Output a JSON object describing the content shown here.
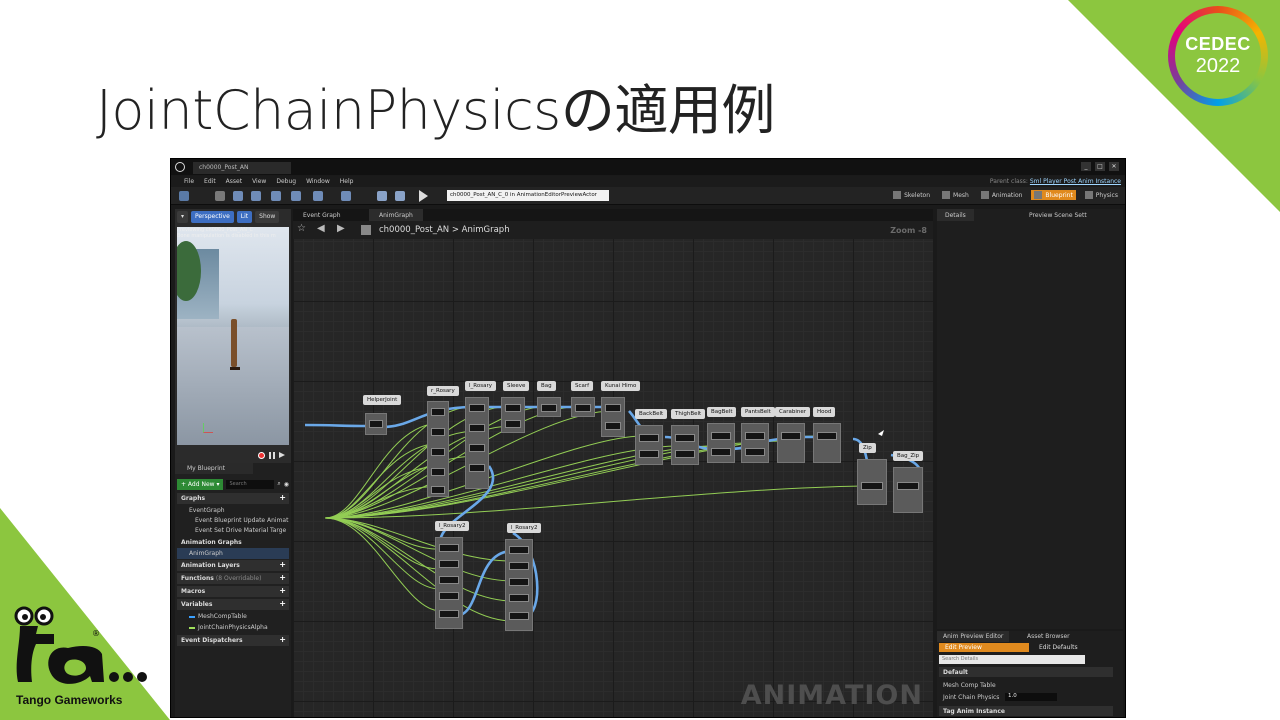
{
  "slide": {
    "title": "JointChainPhysicsの適用例",
    "cedec": {
      "name": "CEDEC",
      "year": "2022"
    },
    "company": "Tango Gameworks"
  },
  "editor": {
    "asset_tab": "ch0000_Post_AN",
    "parent_class_label": "Parent class:",
    "parent_class_value": "Sml Player Post Anim Instance",
    "menu": [
      "File",
      "Edit",
      "Asset",
      "View",
      "Debug",
      "Window",
      "Help"
    ],
    "debug_object": "ch0000_Post_AN_C_0 in AnimationEditorPreviewActor",
    "modes": [
      {
        "label": "Skeleton",
        "active": false
      },
      {
        "label": "Mesh",
        "active": false
      },
      {
        "label": "Animation",
        "active": false
      },
      {
        "label": "Blueprint",
        "active": true
      },
      {
        "label": "Physics",
        "active": false
      }
    ],
    "viewport": {
      "perspective": "Perspective",
      "lit": "Lit",
      "show": "Show",
      "message_line1": "Previewing ch0000_Post_AN_C",
      "message_line2": "Bone manipulation is disabled in this m"
    },
    "my_blueprint": {
      "tab": "My Blueprint",
      "add_new": "+ Add New ▾",
      "search_placeholder": "Search",
      "graphs": "Graphs",
      "event_graph": "EventGraph",
      "event1": "Event Blueprint Update Animat",
      "event2": "Event Set Drive Material Targe",
      "animation_graphs": "Animation Graphs",
      "anim_graph": "AnimGraph",
      "animation_layers": "Animation Layers",
      "functions": "Functions",
      "functions_note": "(8 Overridable)",
      "macros": "Macros",
      "variables": "Variables",
      "var1": "MeshCompTable",
      "var2": "JointChainPhysicsAlpha",
      "event_dispatchers": "Event Dispatchers"
    },
    "graph": {
      "tabs": [
        "Event Graph",
        "AnimGraph"
      ],
      "breadcrumb": "ch0000_Post_AN  >  AnimGraph",
      "zoom": "Zoom -8",
      "watermark": "ANIMATION",
      "node_labels": [
        "HelperJoint",
        "r_Rosary",
        "l_Rosary",
        "Sleeve",
        "Bag",
        "Scarf",
        "Kunai Himo",
        "BackBelt",
        "ThighBelt",
        "BagBelt",
        "PantsBelt",
        "Carabiner",
        "Hood",
        "Zip",
        "Bag_Zip",
        "l_Rosary2",
        "l_Rosary2"
      ]
    },
    "details": {
      "tab": "Details",
      "tab2": "Preview Scene Sett"
    },
    "preview_editor": {
      "tab1": "Anim Preview Editor",
      "tab2": "Asset Browser",
      "edit_preview": "Edit Preview",
      "edit_defaults": "Edit Defaults",
      "search_placeholder": "Search Details",
      "section_default": "Default",
      "row_mesh": "Mesh Comp Table",
      "row_jcp": "Joint Chain Physics",
      "row_jcp_value": "1.0",
      "row_next": "Tag Anim Instance"
    }
  },
  "colors": {
    "accent_green": "#8cc63f",
    "wire_blue": "#6aa8e8",
    "wire_green": "#9fe05a",
    "active_orange": "#e08a1e"
  }
}
